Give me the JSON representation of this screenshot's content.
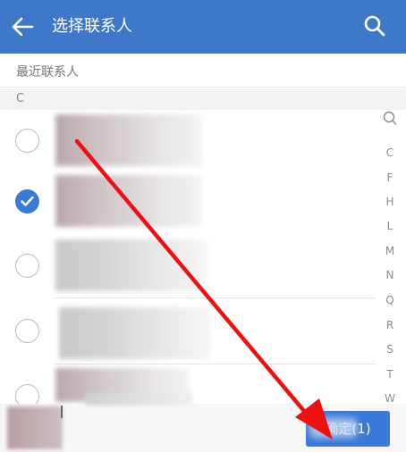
{
  "header": {
    "title": "选择联系人",
    "back_icon": "back-arrow-icon",
    "search_icon": "search-icon"
  },
  "recent": {
    "label": "最近联系人"
  },
  "section": {
    "letter": "C"
  },
  "contacts": [
    {
      "selected": false
    },
    {
      "selected": true
    },
    {
      "selected": false
    },
    {
      "selected": false
    },
    {
      "selected": false
    }
  ],
  "index_bar": {
    "search_icon": "search-icon",
    "letters": [
      "C",
      "F",
      "H",
      "L",
      "M",
      "N",
      "Q",
      "R",
      "S",
      "T",
      "W"
    ]
  },
  "bottom": {
    "confirm_label": "确定(1)"
  },
  "annotation": {
    "arrow_color": "#ee1111"
  },
  "colors": {
    "primary": "#3f78c8",
    "accent": "#3a7ad8"
  }
}
